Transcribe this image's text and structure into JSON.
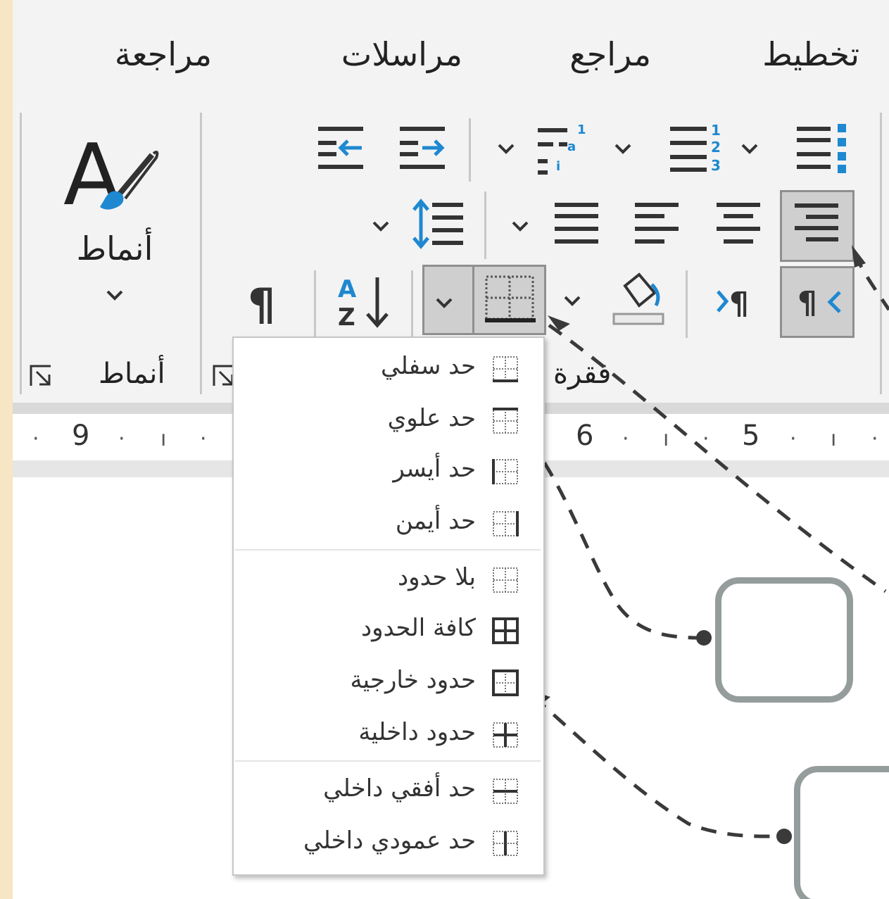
{
  "tabs": [
    "تخطيط",
    "مراجع",
    "مراسلات",
    "مراجعة"
  ],
  "styles_gallery": {
    "label": "أنماط"
  },
  "groups": {
    "paragraph": "فقرة",
    "styles": "أنماط"
  },
  "ruler": {
    "numbers": [
      "5",
      "6",
      "9"
    ]
  },
  "borders_menu": {
    "items": [
      "حد سفلي",
      "حد علوي",
      "حد أيسر",
      "حد أيمن",
      "بلا حدود",
      "كافة الحدود",
      "حدود خارجية",
      "حدود داخلية",
      "حد أفقي داخلي",
      "حد عمودي داخلي"
    ]
  },
  "icons": {
    "bullets": "bullets-icon",
    "numbering": "numbering-icon",
    "multilevel": "multilevel-list-icon",
    "decrease_indent": "decrease-indent-icon",
    "increase_indent": "increase-indent-icon",
    "align_right": "align-right-icon",
    "center": "align-center-icon",
    "align_left": "align-left-icon",
    "justify": "justify-icon",
    "line_spacing": "line-spacing-icon",
    "rtl": "rtl-paragraph-icon",
    "ltr": "ltr-paragraph-icon",
    "shading": "shading-icon",
    "borders": "borders-icon",
    "sort": "sort-icon",
    "show_marks": "pilcrow-icon",
    "styles": "styles-brush-icon"
  },
  "colors": {
    "accent": "#1e88d0",
    "ribbon_bg": "#f3f3f3",
    "shape_border": "#949c9c"
  }
}
